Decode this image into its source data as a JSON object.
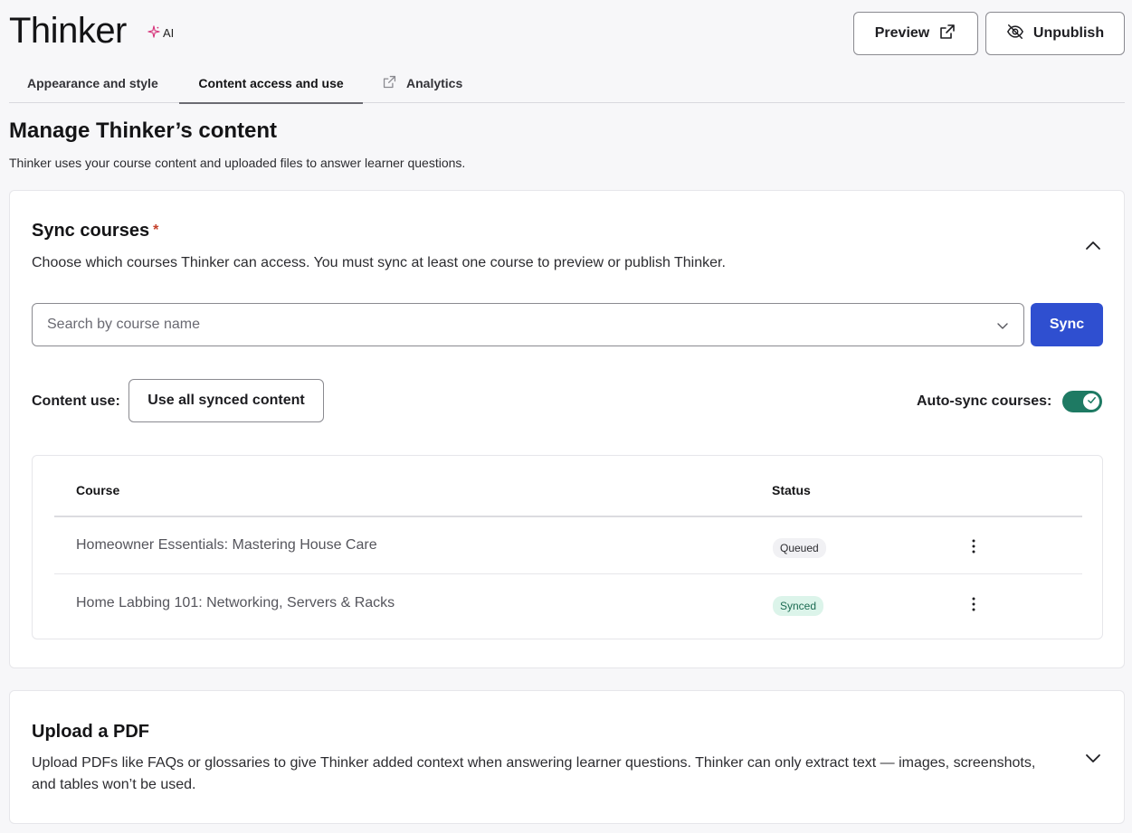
{
  "header": {
    "title": "Thinker",
    "ai_badge": "AI",
    "preview_label": "Preview",
    "unpublish_label": "Unpublish"
  },
  "tabs": [
    {
      "label": "Appearance and style"
    },
    {
      "label": "Content access and use"
    },
    {
      "label": "Analytics"
    }
  ],
  "page": {
    "title": "Manage Thinker’s content",
    "subtitle": "Thinker uses your course content and uploaded files to answer learner questions."
  },
  "sync_section": {
    "title": "Sync courses",
    "required_mark": "*",
    "description": "Choose which courses Thinker can access. You must sync at least one course to preview or publish Thinker.",
    "search_placeholder": "Search by course name",
    "sync_button": "Sync",
    "content_use_label": "Content use:",
    "content_use_value": "Use all synced content",
    "autosync_label": "Auto-sync courses:",
    "autosync_on": true,
    "toggle_color": "#1e7a63",
    "table": {
      "headers": {
        "course": "Course",
        "status": "Status"
      },
      "rows": [
        {
          "course": "Homeowner Essentials: Mastering House Care",
          "status": "Queued"
        },
        {
          "course": "Home Labbing 101: Networking, Servers & Racks",
          "status": "Synced"
        }
      ]
    }
  },
  "upload_section": {
    "title": "Upload a PDF",
    "description": "Upload PDFs like FAQs or glossaries to give Thinker added context when answering learner questions. Thinker can only extract text — images, screenshots, and tables won’t be used."
  },
  "colors": {
    "primary": "#2f4fd0",
    "synced_bg": "#dcf4ea",
    "queued_bg": "#f1f1f4",
    "required": "#c4412b"
  }
}
